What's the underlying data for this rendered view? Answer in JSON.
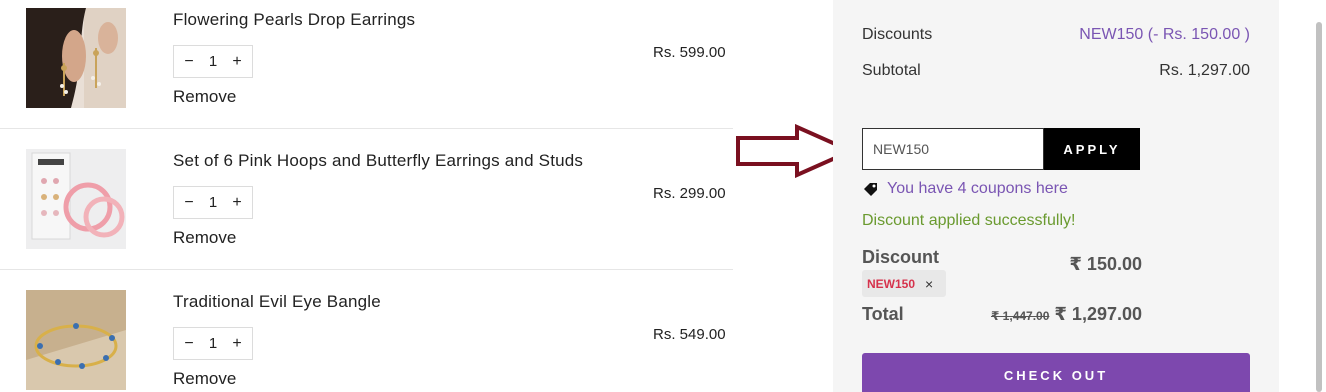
{
  "cart": {
    "items": [
      {
        "name": "Flowering Pearls Drop Earrings",
        "quantity": "1",
        "price": "Rs. 599.00",
        "remove_label": "Remove",
        "decrement": "−",
        "increment": "+",
        "image": "earrings-model-photo"
      },
      {
        "name": "Set of 6 Pink Hoops and Butterfly Earrings and Studs",
        "quantity": "1",
        "price": "Rs. 299.00",
        "remove_label": "Remove",
        "decrement": "−",
        "increment": "+",
        "image": "pink-hoops-set-photo"
      },
      {
        "name": "Traditional Evil Eye Bangle",
        "quantity": "1",
        "price": "Rs. 549.00",
        "remove_label": "Remove",
        "decrement": "−",
        "increment": "+",
        "image": "evil-eye-bangle-photo"
      }
    ]
  },
  "summary": {
    "discounts_label": "Discounts",
    "discounts_value": "NEW150 (- Rs. 150.00 )",
    "subtotal_label": "Subtotal",
    "subtotal_value": "Rs. 1,297.00",
    "coupon_input_value": "NEW150",
    "apply_label": "APPLY",
    "coupons_link": "You have 4 coupons here",
    "success_message": "Discount applied successfully!",
    "discount_label": "Discount",
    "discount_amount": "₹ 150.00",
    "applied_code": "NEW150",
    "remove_code_icon": "×",
    "total_label": "Total",
    "total_original": "₹ 1,447.00",
    "total_final": "₹ 1,297.00",
    "checkout_label": "CHECK OUT"
  },
  "colors": {
    "accent_purple": "#7d48ae",
    "link_purple": "#7a55b3",
    "success_green": "#6a9a2f",
    "code_red": "#d6324c",
    "arrow_red": "#7a1020"
  },
  "icons": {
    "arrow": "annotation-arrow-right",
    "tag": "price-tag-icon",
    "remove_code": "close-icon"
  }
}
